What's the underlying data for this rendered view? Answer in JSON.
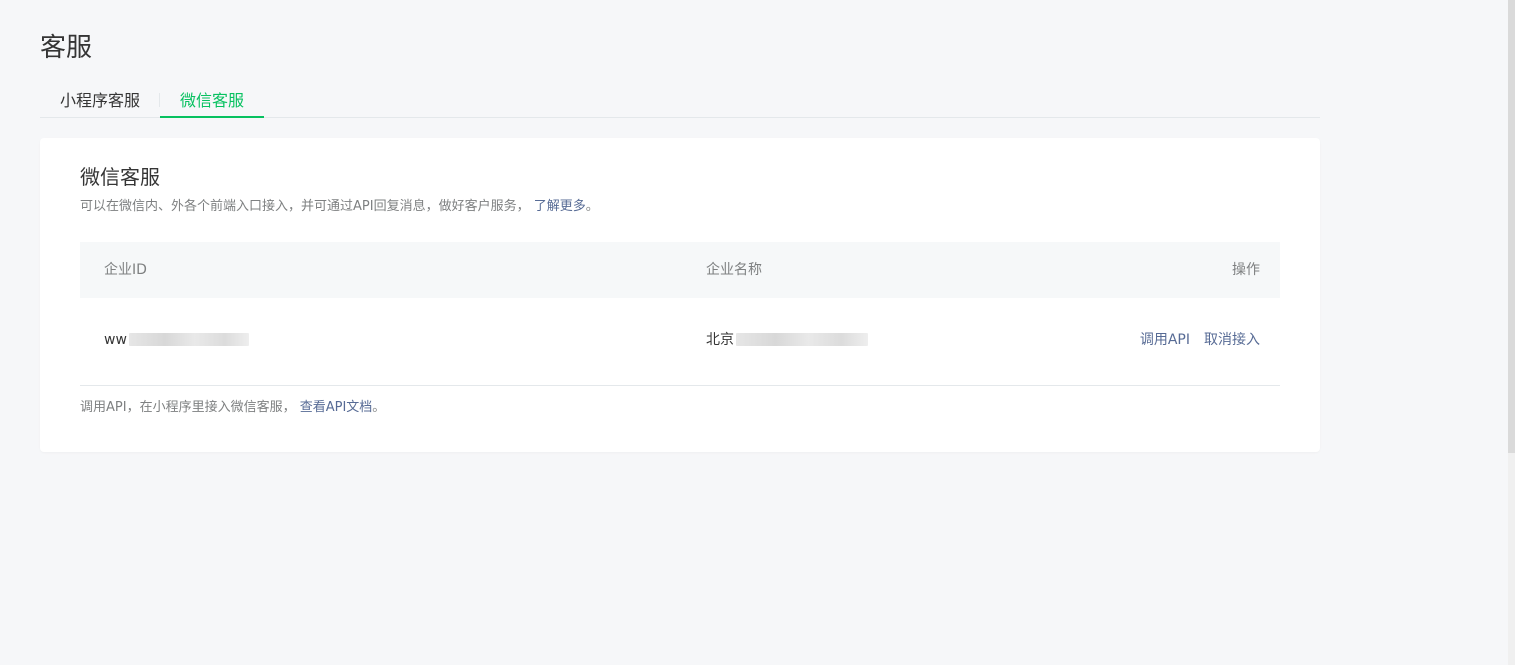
{
  "page": {
    "title": "客服"
  },
  "tabs": [
    {
      "label": "小程序客服",
      "active": false
    },
    {
      "label": "微信客服",
      "active": true
    }
  ],
  "card": {
    "title": "微信客服",
    "description": "可以在微信内、外各个前端入口接入，并可通过API回复消息，做好客户服务，",
    "learn_more": "了解更多",
    "desc_end": "。"
  },
  "table": {
    "headers": {
      "id": "企业ID",
      "name": "企业名称",
      "operation": "操作"
    },
    "rows": [
      {
        "id_prefix": "ww",
        "name_prefix": "北京",
        "actions": {
          "call_api": "调用API",
          "cancel": "取消接入"
        }
      }
    ]
  },
  "footer": {
    "text": "调用API，在小程序里接入微信客服，",
    "link": "查看API文档",
    "end": "。"
  },
  "colors": {
    "accent": "#07c160",
    "link": "#576b95",
    "background": "#f6f7f9"
  }
}
